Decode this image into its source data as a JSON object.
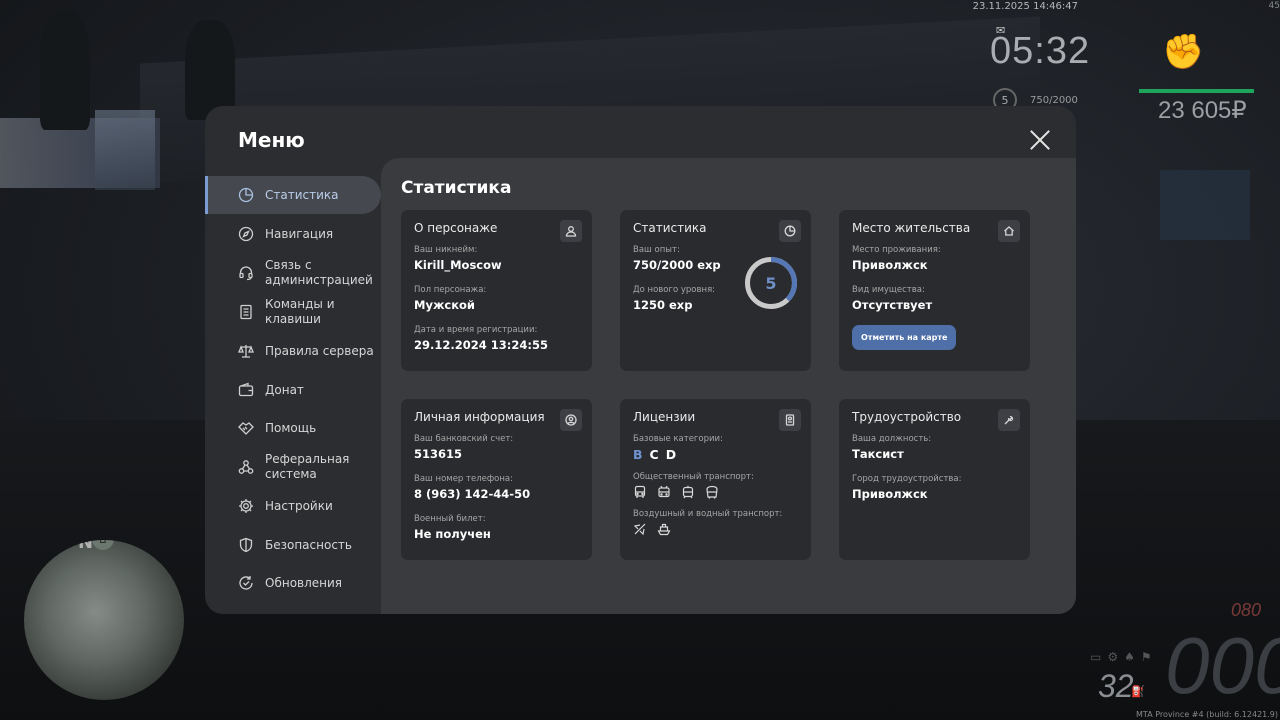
{
  "hud": {
    "datetime": "23.11.2025 14:46:47",
    "corner_value": "45",
    "clock": "05:32",
    "level": "5",
    "exp": "750/2000",
    "money": "23 605₽",
    "fuel": "32",
    "speed": "000",
    "speed_max": "080",
    "minimap_north": "N",
    "build_info": "MTA Province #4 (build: 6.12421.9)"
  },
  "menu": {
    "title": "Меню",
    "sidebar": [
      {
        "label": "Статистика",
        "icon": "pie-chart-icon",
        "active": true
      },
      {
        "label": "Навигация",
        "icon": "compass-icon"
      },
      {
        "label": "Связь с администрацией",
        "icon": "headset-icon"
      },
      {
        "label": "Команды и клавиши",
        "icon": "document-icon"
      },
      {
        "label": "Правила сервера",
        "icon": "scales-icon"
      },
      {
        "label": "Донат",
        "icon": "wallet-icon"
      },
      {
        "label": "Помощь",
        "icon": "handshake-icon"
      },
      {
        "label": "Реферальная система",
        "icon": "network-icon"
      },
      {
        "label": "Настройки",
        "icon": "gear-icon"
      },
      {
        "label": "Безопасность",
        "icon": "shield-icon"
      },
      {
        "label": "Обновления",
        "icon": "refresh-check-icon"
      }
    ]
  },
  "content": {
    "title": "Статистика",
    "character": {
      "title": "О персонаже",
      "nickname_label": "Ваш никнейм:",
      "nickname": "Kirill_Moscow",
      "gender_label": "Пол персонажа:",
      "gender": "Мужской",
      "reg_label": "Дата и время регистрации:",
      "reg": "29.12.2024 13:24:55"
    },
    "stats": {
      "title": "Статистика",
      "exp_label": "Ваш опыт:",
      "exp": "750/2000 exp",
      "next_label": "До нового уровня:",
      "next": "1250 exp",
      "level": "5",
      "progress": 0.375
    },
    "residence": {
      "title": "Место жительства",
      "place_label": "Место проживания:",
      "place": "Приволжск",
      "property_label": "Вид имущества:",
      "property": "Отсутствует",
      "map_button": "Отметить на карте"
    },
    "personal": {
      "title": "Личная информация",
      "bank_label": "Ваш банковский счет:",
      "bank": "513615",
      "phone_label": "Ваш номер телефона:",
      "phone": "8 (963) 142-44-50",
      "military_label": "Военный билет:",
      "military": "Не получен"
    },
    "licenses": {
      "title": "Лицензии",
      "base_label": "Базовые категории:",
      "cat_b": "B",
      "cat_c": "C",
      "cat_d": "D",
      "public_label": "Общественный транспорт:",
      "air_label": "Воздушный и водный транспорт:",
      "accent": "#6f93cf"
    },
    "job": {
      "title": "Трудоустройство",
      "position_label": "Ваша должность:",
      "position": "Таксист",
      "city_label": "Город трудоустройства:",
      "city": "Приволжск"
    }
  }
}
